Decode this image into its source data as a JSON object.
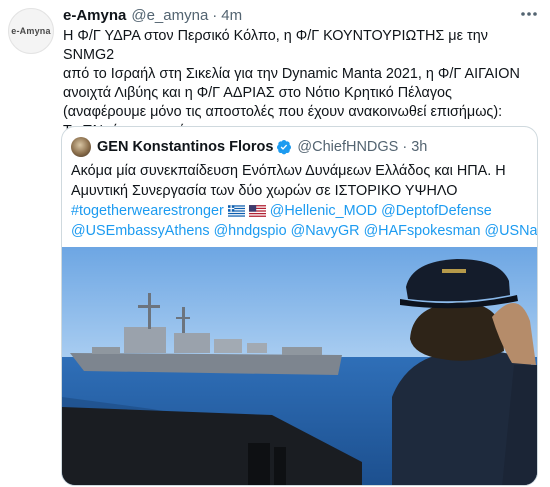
{
  "tweet": {
    "avatar_text": "e-Amyna",
    "author_name": "e-Amyna",
    "author_handle": "@e_amyna",
    "separator": "·",
    "time": "4m",
    "text": "Η Φ/Γ ΥΔΡΑ στον Περσικό Κόλπο, η Φ/Γ ΚΟΥΝΤΟΥΡΙΩΤΗΣ με την SNMG2\nαπό το Ισραήλ στη Σικελία για την Dynamic Manta 2021, η Φ/Γ ΑΙΓΑΙΟΝ\nανοιχτά Λιβύης και η Φ/Γ ΑΔΡΙΑΣ στο Νότιο Κρητικό Πέλαγος\n(αναφέρουμε μόνο τις αποστολές που έχουν ανακοινωθεί επισήμως):\nΤο ΠΝ είναι παντού.",
    "more_icon": "more-options-icon"
  },
  "quoted": {
    "author_name": "GEN Konstantinos Floros",
    "author_handle": "@ChiefHNDGS",
    "separator": "·",
    "time": "3h",
    "line1": "Ακόμα μία συνεκπαίδευση Ενόπλων Δυνάμεων Ελλάδος και ΗΠΑ. Η",
    "line2": "Αμυντική Συνεργασία των δύο χωρών σε ΙΣΤΟΡΙΚΟ ΥΨΗΛΟ",
    "line3_hashtag": "#togetherwearestronger",
    "line3_mention": "@Hellenic_MOD @DeptofDefense",
    "line4": "@USEmbassyAthens @hndgspio @NavyGR @HAFspokesman @USNavy",
    "flag_icons": [
      "greece-flag-icon",
      "usa-flag-icon"
    ],
    "verified_icon": "verified-badge-icon",
    "verified_color": "#1d9bf0",
    "link_color": "#1d9bf0"
  }
}
